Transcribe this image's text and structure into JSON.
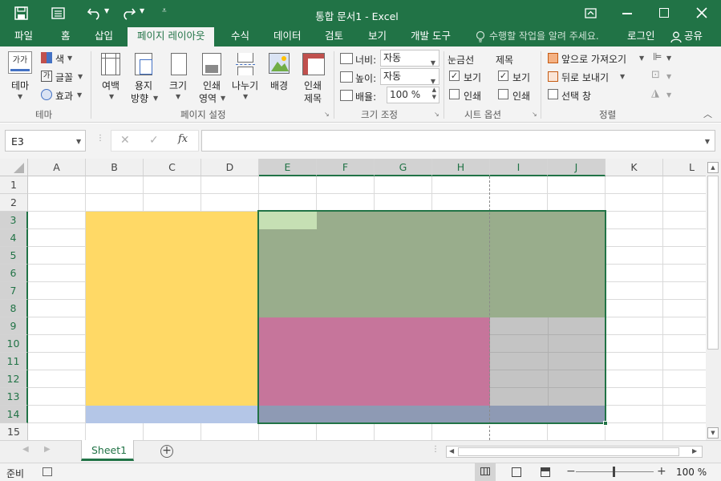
{
  "titlebar": {
    "title": "통합 문서1 - Excel",
    "save_icon": "save-icon",
    "qat_icon": "form-icon",
    "undo_icon": "undo-icon",
    "redo_icon": "redo-icon",
    "customize_icon": "customize-qat-icon",
    "ribbon_display_icon": "ribbon-display-options-icon",
    "minimize_icon": "minimize-icon",
    "maximize_icon": "maximize-icon",
    "close_icon": "close-icon"
  },
  "tabs": [
    "파일",
    "홈",
    "삽입",
    "페이지 레이아웃",
    "수식",
    "데이터",
    "검토",
    "보기",
    "개발 도구"
  ],
  "active_tab": "페이지 레이아웃",
  "tell_me": "수행할 작업을 알려 주세요.",
  "login": "로그인",
  "share": "공유",
  "ribbon": {
    "theme": {
      "theme_label": "테마",
      "colors": "색",
      "fonts": "글꼴",
      "effects": "효과",
      "group": "테마"
    },
    "page_setup": {
      "margins": "여백",
      "orientation_1": "용지",
      "orientation_2": "방향",
      "size": "크기",
      "print_area_1": "인쇄",
      "print_area_2": "영역",
      "breaks": "나누기",
      "background": "배경",
      "print_titles_1": "인쇄",
      "print_titles_2": "제목",
      "group": "페이지 설정"
    },
    "scale": {
      "width_label": "너비:",
      "width_value": "자동",
      "height_label": "높이:",
      "height_value": "자동",
      "scale_label": "배율:",
      "scale_value": "100 %",
      "group": "크기 조정"
    },
    "sheet_options": {
      "gridlines": "눈금선",
      "headings": "제목",
      "view": "보기",
      "print": "인쇄",
      "gridlines_view_checked": true,
      "gridlines_print_checked": false,
      "headings_view_checked": true,
      "headings_print_checked": false,
      "group": "시트 옵션"
    },
    "arrange": {
      "bring_forward": "앞으로 가져오기",
      "send_backward": "뒤로 보내기",
      "selection_pane": "선택 창",
      "group": "정렬"
    }
  },
  "formula_bar": {
    "name_box": "E3",
    "fx": "fx",
    "formula": ""
  },
  "columns": [
    "A",
    "B",
    "C",
    "D",
    "E",
    "F",
    "G",
    "H",
    "I",
    "J",
    "K",
    "L"
  ],
  "rows": [
    "1",
    "2",
    "3",
    "4",
    "5",
    "6",
    "7",
    "8",
    "9",
    "10",
    "11",
    "12",
    "13",
    "14",
    "15"
  ],
  "selected_cell": "E3",
  "selected_range": "E3:J14",
  "fill_colors": {
    "yellow": "#ffd966",
    "blue": "#b4c6e7",
    "green": "#99ad8c",
    "active": "#c6e0b4",
    "pink": "#c6759b",
    "gray": "#c4c4c4",
    "overlap": "#8e9ab4"
  },
  "sheet_tab": "Sheet1",
  "status": {
    "ready": "준비",
    "zoom": "100 %"
  }
}
